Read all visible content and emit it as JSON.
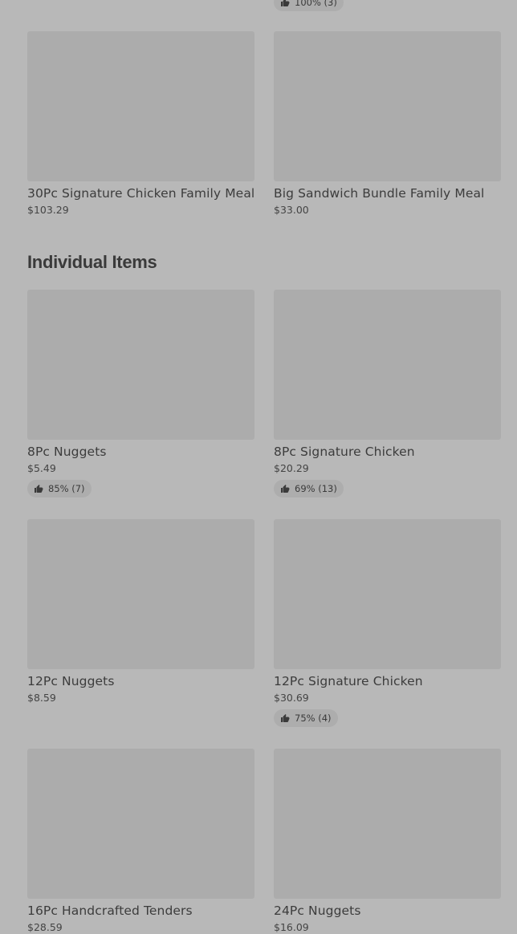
{
  "top_rating": {
    "text": "100% (3)"
  },
  "family_meals": [
    {
      "name": "30Pc Signature Chicken Family Meal",
      "price": "$103.29"
    },
    {
      "name": "Big Sandwich Bundle Family Meal",
      "price": "$33.00"
    }
  ],
  "individual_section": {
    "title": "Individual Items"
  },
  "items": [
    {
      "name": "8Pc Nuggets",
      "price": "$5.49",
      "rating": "85% (7)"
    },
    {
      "name": "8Pc Signature Chicken",
      "price": "$20.29",
      "rating": "69% (13)"
    },
    {
      "name": "12Pc Nuggets",
      "price": "$8.59"
    },
    {
      "name": "12Pc Signature Chicken",
      "price": "$30.69",
      "rating": "75% (4)"
    },
    {
      "name": "16Pc Handcrafted Tenders",
      "price": "$28.59"
    },
    {
      "name": "24Pc Nuggets",
      "price": "$16.09"
    }
  ],
  "icons": {
    "rating": "thumbs-up-icon"
  }
}
